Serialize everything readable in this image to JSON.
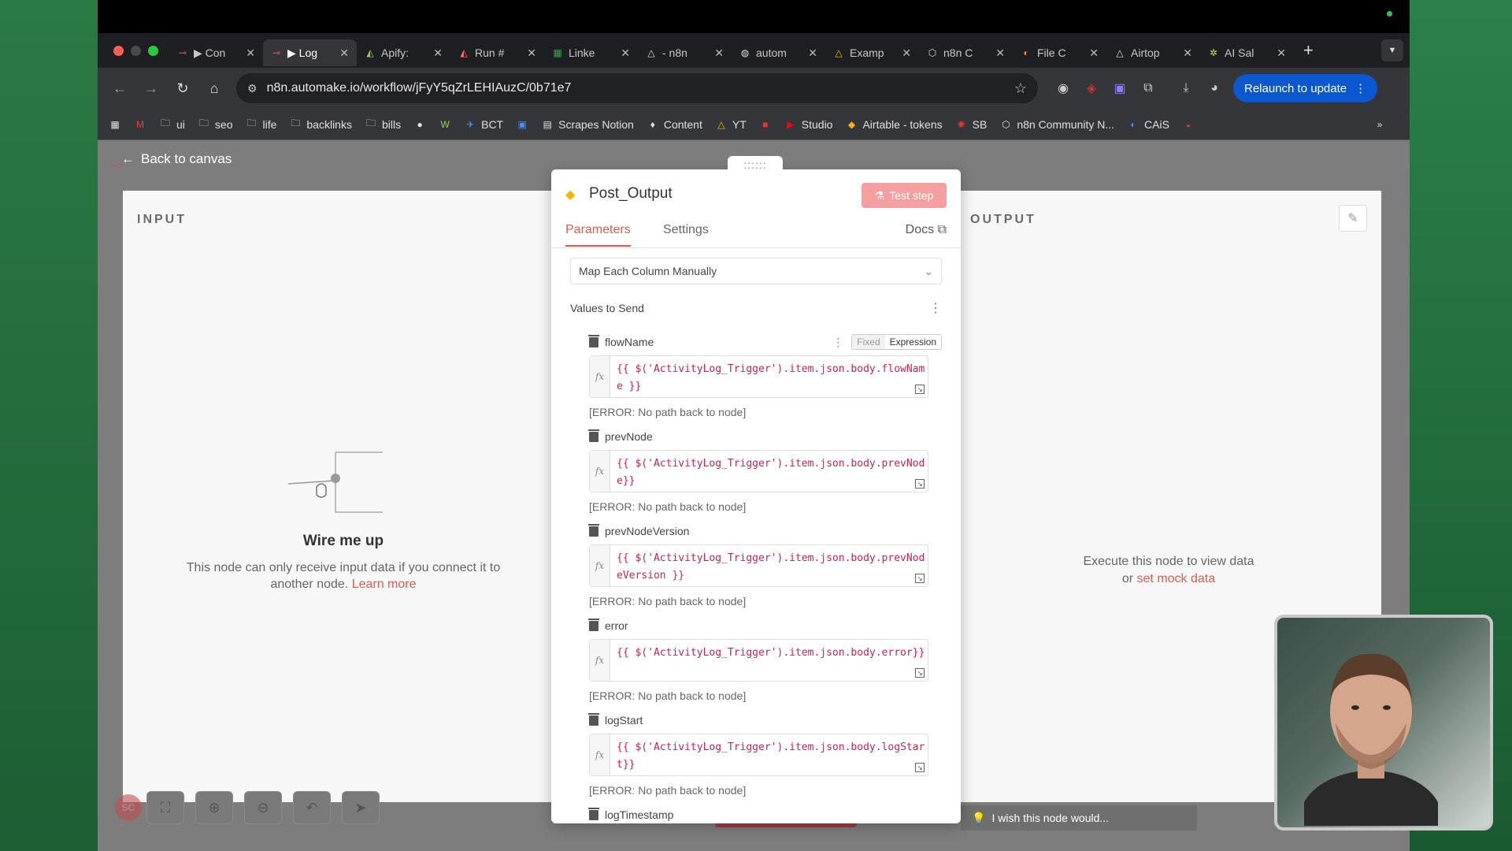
{
  "browser": {
    "tabs": [
      {
        "label": "▶ Con",
        "icon": "n8n-icon",
        "active": false
      },
      {
        "label": "▶ Log",
        "icon": "n8n-icon",
        "active": true
      },
      {
        "label": "Apify:",
        "icon": "apify-icon",
        "active": false
      },
      {
        "label": "Run #",
        "icon": "apify-icon",
        "active": false
      },
      {
        "label": "Linke",
        "icon": "sheets-icon",
        "active": false
      },
      {
        "label": "- n8n",
        "icon": "drive-icon",
        "active": false
      },
      {
        "label": "autom",
        "icon": "globe-icon",
        "active": false
      },
      {
        "label": "Examp",
        "icon": "drive-icon",
        "active": false
      },
      {
        "label": "n8n C",
        "icon": "cube-icon",
        "active": false
      },
      {
        "label": "File C",
        "icon": "file-icon",
        "active": false
      },
      {
        "label": "Airtop",
        "icon": "drive-icon",
        "active": false
      },
      {
        "label": "AI Sal",
        "icon": "spark-icon",
        "active": false
      }
    ],
    "url": "n8n.automake.io/workflow/jFyY5qZrLEHIAuzC/0b71e7",
    "relaunch_label": "Relaunch to update",
    "bookmarks": [
      "ui",
      "seo",
      "life",
      "backlinks",
      "bills",
      "BCT",
      "Scrapes Notion",
      "Content",
      "YT",
      "Studio",
      "Airtable - tokens",
      "SB",
      "n8n Community N...",
      "CAiS"
    ]
  },
  "app": {
    "back_label": "Back to canvas",
    "input_title": "INPUT",
    "output_title": "OUTPUT",
    "wire_title": "Wire me up",
    "wire_desc": "This node can only receive input data if you connect it to another node.",
    "wire_link": "Learn more",
    "exec_msg": "Execute this node to view data",
    "exec_or": "or",
    "exec_link": "set mock data",
    "wish_label": "I wish this node would...",
    "avatar_initials": "SC"
  },
  "node": {
    "title": "Post_Output",
    "test_step": "Test step",
    "tabs": [
      "Parameters",
      "Settings"
    ],
    "docs": "Docs",
    "mapping_mode": "Map Each Column Manually",
    "values_label": "Values to Send",
    "toggle_fixed": "Fixed",
    "toggle_expression": "Expression",
    "fx_label": "fx",
    "fields": [
      {
        "name": "flowName",
        "expr": "{{ $('ActivityLog_Trigger').item.json.body.flowName }}",
        "error": "[ERROR: No path back to node]"
      },
      {
        "name": "prevNode",
        "expr": "{{ $('ActivityLog_Trigger').item.json.body.prevNode}}",
        "error": "[ERROR: No path back to node]"
      },
      {
        "name": "prevNodeVersion",
        "expr": "{{ $('ActivityLog_Trigger').item.json.body.prevNodeVersion }}",
        "error": "[ERROR: No path back to node]"
      },
      {
        "name": "error",
        "expr": "{{ $('ActivityLog_Trigger').item.json.body.error}}",
        "error": "[ERROR: No path back to node]"
      },
      {
        "name": "logStart",
        "expr": "{{ $('ActivityLog_Trigger').item.json.body.logStart}}",
        "error": "[ERROR: No path back to node]"
      },
      {
        "name": "logTimestamp",
        "expr": "",
        "error": ""
      }
    ]
  }
}
